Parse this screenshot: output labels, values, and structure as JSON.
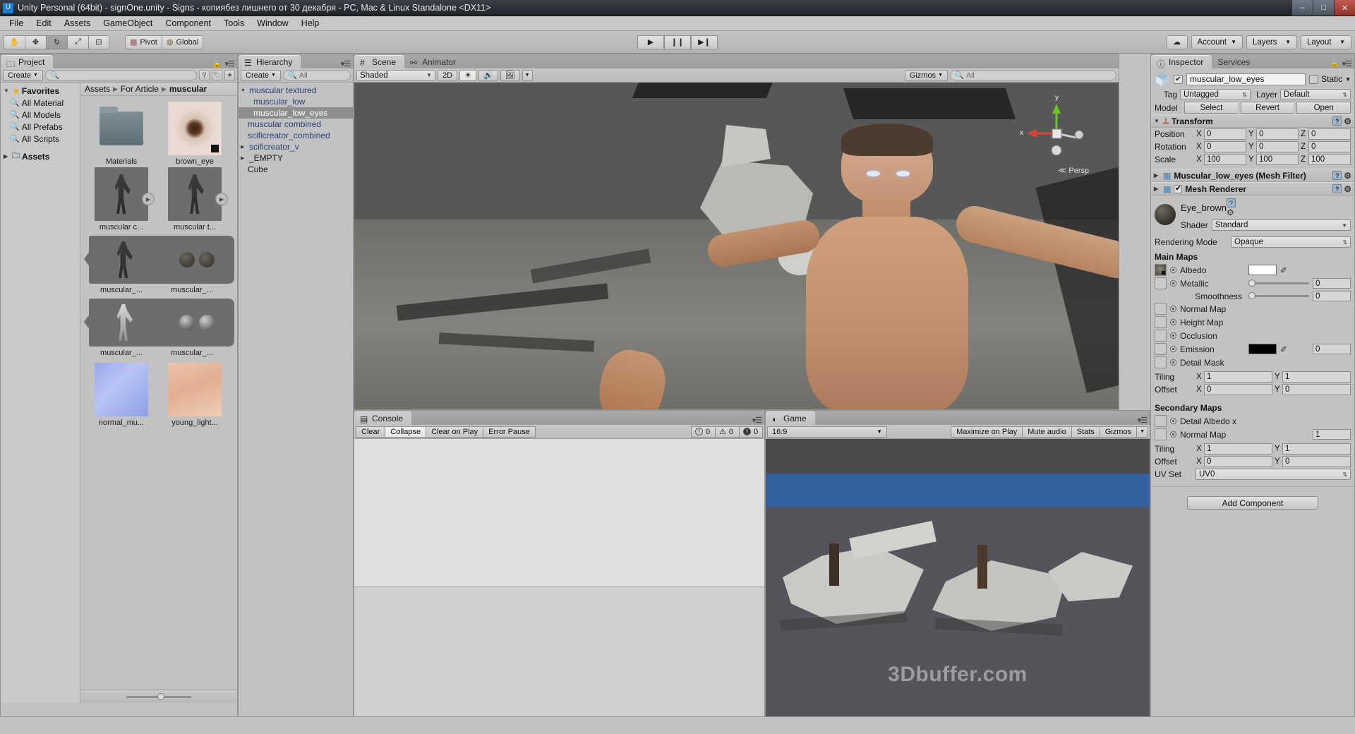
{
  "window": {
    "title": "Unity Personal (64bit) - signOne.unity - Signs - копиябез лишнего от 30 декабря - PC, Mac & Linux Standalone <DX11>",
    "minimize": "–",
    "maximize": "□",
    "close": "✕"
  },
  "menubar": [
    "File",
    "Edit",
    "Assets",
    "GameObject",
    "Component",
    "Tools",
    "Window",
    "Help"
  ],
  "toolbar": {
    "tools": [
      "hand-tool",
      "move-tool",
      "rotate-tool",
      "scale-tool",
      "rect-tool"
    ],
    "pivot_label": "Pivot",
    "global_label": "Global",
    "play": "▶",
    "pause": "❙❙",
    "step": "▶❙",
    "cloud": "☁",
    "account_label": "Account",
    "layers_label": "Layers",
    "layout_label": "Layout"
  },
  "project": {
    "tab": "Project",
    "create_label": "Create",
    "search_placeholder": "",
    "search_value": "",
    "tree": [
      {
        "label": "Favorites",
        "icon": "star-icon",
        "bold": true,
        "indent": 0,
        "arrow": "▼"
      },
      {
        "label": "All Material",
        "icon": "search-icon",
        "bold": false,
        "indent": 1,
        "arrow": ""
      },
      {
        "label": "All Models",
        "icon": "search-icon",
        "bold": false,
        "indent": 1,
        "arrow": ""
      },
      {
        "label": "All Prefabs",
        "icon": "search-icon",
        "bold": false,
        "indent": 1,
        "arrow": ""
      },
      {
        "label": "All Scripts",
        "icon": "search-icon",
        "bold": false,
        "indent": 1,
        "arrow": ""
      },
      {
        "label": "Assets",
        "icon": "folder-icon",
        "bold": true,
        "indent": 0,
        "arrow": "▶"
      }
    ],
    "breadcrumbs": [
      "Assets",
      "For Article",
      "muscular"
    ],
    "assets_row1": [
      {
        "label": "Materials",
        "kind": "folder"
      },
      {
        "label": "brown_eye",
        "kind": "texture-eye"
      }
    ],
    "assets_row2": [
      {
        "label": "muscular c...",
        "kind": "model",
        "badge": true
      },
      {
        "label": "muscular t...",
        "kind": "model",
        "badge": true
      }
    ],
    "assets_row3": [
      {
        "label": "muscular_...",
        "kind": "model"
      },
      {
        "label": "muscular_...",
        "kind": "spheres"
      }
    ],
    "assets_row4": [
      {
        "label": "muscular_...",
        "kind": "model-wire"
      },
      {
        "label": "muscular_...",
        "kind": "spheres2"
      }
    ],
    "assets_row5": [
      {
        "label": "normal_mu...",
        "kind": "normalmap"
      },
      {
        "label": "young_light...",
        "kind": "skintex"
      }
    ],
    "zoom_slider": 48
  },
  "hierarchy": {
    "tab": "Hierarchy",
    "create_label": "Create",
    "search_placeholder": "All",
    "items": [
      {
        "label": "muscular textured",
        "indent": 0,
        "arrow": "▼",
        "selected": false,
        "style": "blue"
      },
      {
        "label": "muscular_low",
        "indent": 1,
        "arrow": "",
        "selected": false,
        "style": "blue"
      },
      {
        "label": "muscular_low_eyes",
        "indent": 1,
        "arrow": "",
        "selected": true,
        "style": "blue"
      },
      {
        "label": "muscular combined",
        "indent": 0,
        "arrow": "",
        "selected": false,
        "style": "blue"
      },
      {
        "label": "scificreator_combined",
        "indent": 0,
        "arrow": "",
        "selected": false,
        "style": "blue"
      },
      {
        "label": "scificreator_v",
        "indent": 0,
        "arrow": "▶",
        "selected": false,
        "style": "blue"
      },
      {
        "label": "_EMPTY",
        "indent": 0,
        "arrow": "▶",
        "selected": false,
        "style": "black"
      },
      {
        "label": "Cube",
        "indent": 0,
        "arrow": "",
        "selected": false,
        "style": "black"
      }
    ]
  },
  "scene": {
    "tabs": [
      {
        "label": "Scene",
        "active": true
      },
      {
        "label": "Animator",
        "active": false
      }
    ],
    "draw_mode": "Shaded",
    "mode_2d": "2D",
    "lighting_icon": "sun-icon",
    "audio_icon": "speaker-icon",
    "effects_icon": "image-icon",
    "gizmos_label": "Gizmos",
    "search_placeholder": "All",
    "persp_label": "Persp",
    "axis_x": "x",
    "axis_y": "y"
  },
  "console": {
    "tab": "Console",
    "clear_label": "Clear",
    "collapse_label": "Collapse",
    "clear_on_play_label": "Clear on Play",
    "error_pause_label": "Error Pause",
    "counts": {
      "info": "0",
      "warning": "0",
      "error": "0"
    }
  },
  "game": {
    "tab": "Game",
    "aspect": "16:9",
    "maximize_label": "Maximize on Play",
    "mute_label": "Mute audio",
    "stats_label": "Stats",
    "gizmos_label": "Gizmos",
    "watermark": "3Dbuffer.com"
  },
  "inspector": {
    "tabs": [
      {
        "label": "Inspector",
        "active": true
      },
      {
        "label": "Services",
        "active": false
      }
    ],
    "object_name": "muscular_low_eyes",
    "enabled": true,
    "static_label": "Static",
    "tag_label": "Tag",
    "tag_value": "Untagged",
    "layer_label": "Layer",
    "layer_value": "Default",
    "model_label": "Model",
    "model_buttons": [
      "Select",
      "Revert",
      "Open"
    ],
    "transform": {
      "title": "Transform",
      "rows": [
        {
          "label": "Position",
          "x": "0",
          "y": "0",
          "z": "0"
        },
        {
          "label": "Rotation",
          "x": "0",
          "y": "0",
          "z": "0"
        },
        {
          "label": "Scale",
          "x": "100",
          "y": "100",
          "z": "100"
        }
      ],
      "axis_labels": [
        "X",
        "Y",
        "Z"
      ]
    },
    "mesh_filter_title": "Muscular_low_eyes (Mesh Filter)",
    "mesh_renderer_title": "Mesh Renderer",
    "mesh_renderer_enabled": true,
    "material": {
      "name": "Eye_brown",
      "shader_label": "Shader",
      "shader_value": "Standard",
      "rendering_mode_label": "Rendering Mode",
      "rendering_mode_value": "Opaque",
      "main_maps_title": "Main Maps",
      "maps": [
        {
          "label": "Albedo",
          "type": "color",
          "color": "#ffffff",
          "thumb": "filled"
        },
        {
          "label": "Metallic",
          "type": "slider",
          "value": "0",
          "slider_pos": 0,
          "thumb": "empty"
        },
        {
          "label": "Smoothness",
          "type": "slider-indent",
          "value": "0",
          "slider_pos": 0
        },
        {
          "label": "Normal Map",
          "type": "plain",
          "thumb": "empty"
        },
        {
          "label": "Height Map",
          "type": "plain",
          "thumb": "empty"
        },
        {
          "label": "Occlusion",
          "type": "plain",
          "thumb": "empty"
        },
        {
          "label": "Emission",
          "type": "color-num",
          "color": "#000000",
          "value": "0",
          "thumb": "empty"
        },
        {
          "label": "Detail Mask",
          "type": "plain",
          "thumb": "empty"
        }
      ],
      "tiling_label": "Tiling",
      "tiling": {
        "x": "1",
        "y": "1"
      },
      "offset_label": "Offset",
      "offset": {
        "x": "0",
        "y": "0"
      },
      "secondary_title": "Secondary Maps",
      "secondary_maps": [
        {
          "label": "Detail Albedo x",
          "type": "plain"
        },
        {
          "label": "Normal Map",
          "type": "num",
          "value": "1"
        }
      ],
      "sec_tiling": {
        "x": "1",
        "y": "1"
      },
      "sec_offset": {
        "x": "0",
        "y": "0"
      },
      "uv_set_label": "UV Set",
      "uv_set_value": "UV0"
    },
    "add_component_label": "Add Component"
  },
  "colors": {
    "panel_bg": "#c2c2c2",
    "accent_blue": "#2c3e73",
    "selection": "#8e8e8e",
    "game_band": "#34609e",
    "axis_red": "#d64535",
    "axis_green": "#6cc22c",
    "axis_blue": "#3c7fd0"
  }
}
